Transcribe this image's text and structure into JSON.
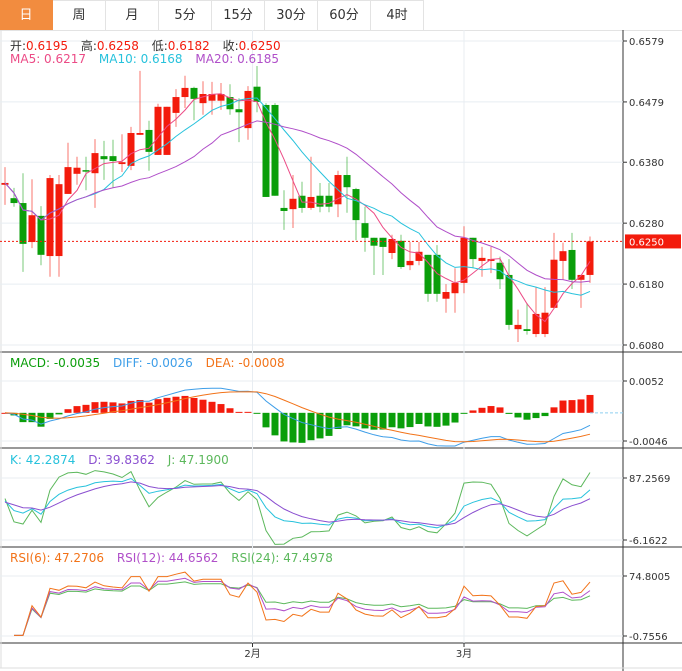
{
  "tabs": [
    "日",
    "周",
    "月",
    "5分",
    "15分",
    "30分",
    "60分",
    "4时"
  ],
  "active_tab": 0,
  "ohlc_legend": {
    "open_label": "开:",
    "open": "0.6195",
    "high_label": "高:",
    "high": "0.6258",
    "low_label": "低:",
    "low": "0.6182",
    "close_label": "收:",
    "close": "0.6250"
  },
  "ma_legend": {
    "ma5": "MA5: 0.6217",
    "ma10": "MA10: 0.6168",
    "ma20": "MA20: 0.6185"
  },
  "macd_legend": {
    "macd": "MACD: -0.0035",
    "diff": "DIFF: -0.0026",
    "dea": "DEA: -0.0008"
  },
  "kdj_legend": {
    "k": "K: 42.2874",
    "d": "D: 39.8362",
    "j": "J: 47.1900"
  },
  "rsi_legend": {
    "rsi6": "RSI(6): 47.2706",
    "rsi12": "RSI(12): 44.6562",
    "rsi24": "RSI(24): 47.4978"
  },
  "price_axis": [
    "0.6579",
    "0.6479",
    "0.6380",
    "0.6280",
    "0.6180",
    "0.6080"
  ],
  "current_price": "0.6250",
  "macd_axis": [
    "0.0052",
    "-0.0046"
  ],
  "kdj_axis": [
    "87.2569",
    "-6.1622"
  ],
  "rsi_axis": [
    "74.8005",
    "-0.7556"
  ],
  "date_labels": [
    {
      "label": "2月",
      "index": 27.5
    },
    {
      "label": "3月",
      "index": 51
    }
  ],
  "colors": {
    "up": "#f31b0c",
    "down": "#0a9e0a",
    "ma5": "#ec4b86",
    "ma10": "#27c2dc",
    "ma20": "#b04fc9",
    "diff": "#3e9ee8",
    "dea": "#f27319",
    "k": "#27c2dc",
    "d": "#8a4fd0",
    "j": "#5cb85c",
    "rsi6": "#f27319",
    "rsi12": "#b04fc9",
    "rsi24": "#5cb85c",
    "accent": "#f28c3f"
  },
  "chart_data": {
    "type": "candlestick",
    "price_range": [
      0.608,
      0.6579
    ],
    "ohlc": [
      [
        0.6343,
        0.6372,
        0.631,
        0.6346
      ],
      [
        0.6321,
        0.6338,
        0.6307,
        0.6313
      ],
      [
        0.6313,
        0.6362,
        0.62,
        0.6246
      ],
      [
        0.6249,
        0.6352,
        0.6239,
        0.6293
      ],
      [
        0.6292,
        0.6308,
        0.6211,
        0.6228
      ],
      [
        0.6226,
        0.6359,
        0.6192,
        0.6354
      ],
      [
        0.6226,
        0.6359,
        0.6192,
        0.6344
      ],
      [
        0.6328,
        0.6412,
        0.6328,
        0.6372
      ],
      [
        0.6361,
        0.6389,
        0.6343,
        0.6371
      ],
      [
        0.6367,
        0.6389,
        0.6334,
        0.6366
      ],
      [
        0.6362,
        0.6418,
        0.6305,
        0.6395
      ],
      [
        0.639,
        0.6415,
        0.6351,
        0.6385
      ],
      [
        0.639,
        0.6417,
        0.6338,
        0.6382
      ],
      [
        0.6377,
        0.6426,
        0.6364,
        0.638
      ],
      [
        0.6374,
        0.6438,
        0.6367,
        0.6428
      ],
      [
        0.6425,
        0.653,
        0.6425,
        0.6428
      ],
      [
        0.6433,
        0.6448,
        0.6366,
        0.6397
      ],
      [
        0.6392,
        0.6476,
        0.6392,
        0.6471
      ],
      [
        0.6392,
        0.6471,
        0.6392,
        0.6471
      ],
      [
        0.6461,
        0.65,
        0.6438,
        0.6487
      ],
      [
        0.6487,
        0.6522,
        0.6469,
        0.6502
      ],
      [
        0.6502,
        0.6504,
        0.6449,
        0.6484
      ],
      [
        0.6477,
        0.6513,
        0.6458,
        0.6492
      ],
      [
        0.6481,
        0.6512,
        0.6458,
        0.6492
      ],
      [
        0.6481,
        0.651,
        0.6466,
        0.6492
      ],
      [
        0.6487,
        0.6508,
        0.6458,
        0.6467
      ],
      [
        0.6467,
        0.6485,
        0.6413,
        0.6462
      ],
      [
        0.6436,
        0.6505,
        0.6417,
        0.6497
      ],
      [
        0.6504,
        0.6538,
        0.6462,
        0.6479
      ],
      [
        0.6474,
        0.6477,
        0.6323,
        0.6323
      ],
      [
        0.6474,
        0.6477,
        0.6325,
        0.6325
      ],
      [
        0.6305,
        0.6334,
        0.6269,
        0.63
      ],
      [
        0.6303,
        0.6359,
        0.6272,
        0.632
      ],
      [
        0.6325,
        0.6348,
        0.6297,
        0.6305
      ],
      [
        0.6305,
        0.6389,
        0.6302,
        0.6323
      ],
      [
        0.6325,
        0.6346,
        0.6298,
        0.6307
      ],
      [
        0.6325,
        0.6346,
        0.6298,
        0.6307
      ],
      [
        0.6311,
        0.6366,
        0.629,
        0.6359
      ],
      [
        0.6359,
        0.6389,
        0.6297,
        0.6339
      ],
      [
        0.6336,
        0.6338,
        0.6252,
        0.6285
      ],
      [
        0.628,
        0.6307,
        0.6233,
        0.6256
      ],
      [
        0.6256,
        0.6256,
        0.6195,
        0.6243
      ],
      [
        0.6256,
        0.6256,
        0.6195,
        0.6241
      ],
      [
        0.6231,
        0.6261,
        0.6221,
        0.6254
      ],
      [
        0.6251,
        0.6261,
        0.6205,
        0.6208
      ],
      [
        0.6211,
        0.6249,
        0.6203,
        0.6218
      ],
      [
        0.6218,
        0.6249,
        0.6211,
        0.6233
      ],
      [
        0.6228,
        0.6228,
        0.6151,
        0.6164
      ],
      [
        0.6228,
        0.6244,
        0.6151,
        0.6164
      ],
      [
        0.6156,
        0.618,
        0.6133,
        0.6167
      ],
      [
        0.6165,
        0.6206,
        0.6133,
        0.6182
      ],
      [
        0.6182,
        0.6275,
        0.6165,
        0.6256
      ],
      [
        0.6256,
        0.6256,
        0.6206,
        0.6221
      ],
      [
        0.6218,
        0.6241,
        0.6192,
        0.6223
      ],
      [
        0.6218,
        0.6241,
        0.6198,
        0.6221
      ],
      [
        0.6215,
        0.6225,
        0.6172,
        0.6188
      ],
      [
        0.6195,
        0.6221,
        0.6105,
        0.6113
      ],
      [
        0.6106,
        0.6138,
        0.6085,
        0.6113
      ],
      [
        0.6106,
        0.6149,
        0.6097,
        0.6103
      ],
      [
        0.6098,
        0.6175,
        0.6093,
        0.6131
      ],
      [
        0.6098,
        0.6175,
        0.6093,
        0.6133
      ],
      [
        0.6141,
        0.6264,
        0.6141,
        0.622
      ],
      [
        0.6218,
        0.6248,
        0.6187,
        0.6234
      ],
      [
        0.6236,
        0.6264,
        0.6172,
        0.6187
      ],
      [
        0.6187,
        0.6195,
        0.6141,
        0.6195
      ],
      [
        0.6195,
        0.6258,
        0.6182,
        0.625
      ]
    ],
    "macd_range": [
      -0.0046,
      0.0052
    ],
    "kdj_range": [
      -6.1622,
      87.2569
    ],
    "rsi_range": [
      -0.7556,
      74.8005
    ]
  }
}
